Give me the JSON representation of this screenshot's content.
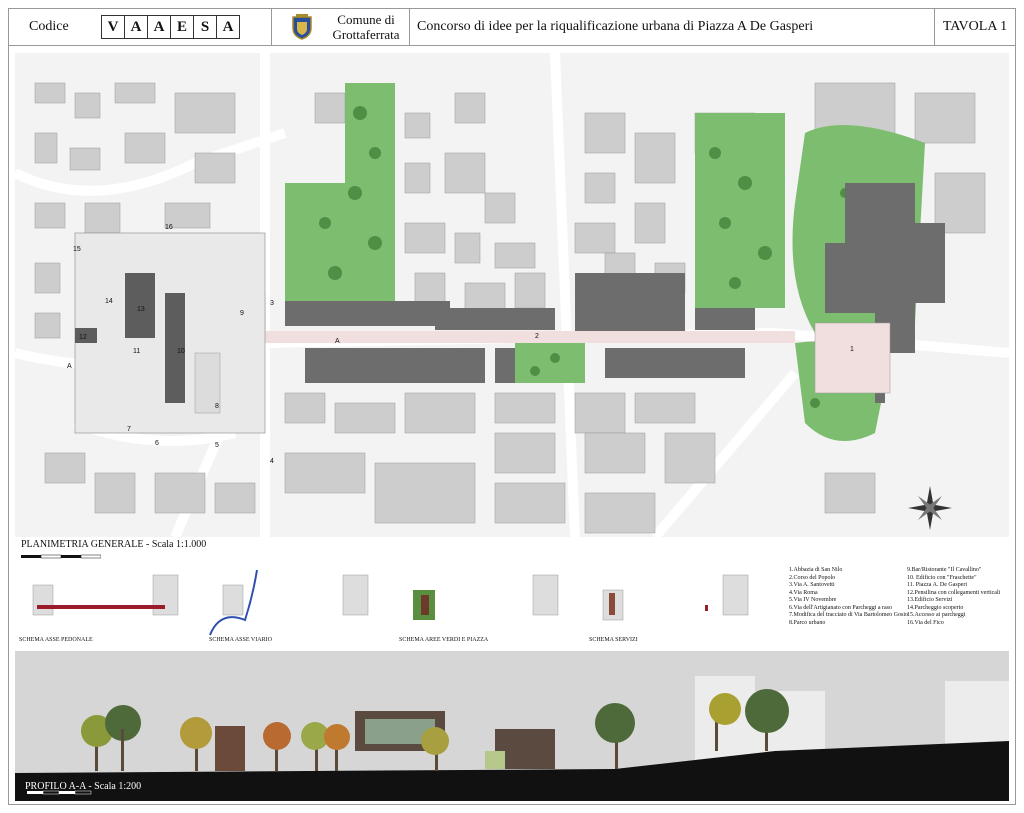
{
  "header": {
    "codice_label": "Codice",
    "code_letters": [
      "V",
      "A",
      "A",
      "E",
      "S",
      "A"
    ],
    "comune_line1": "Comune di",
    "comune_line2": "Grottaferrata",
    "concorso": "Concorso di idee per la riqualificazione urbana di Piazza A De Gasperi",
    "tavola": "TAVOLA 1"
  },
  "plan": {
    "title": "PLANIMETRIA  GENERALE  - Scala 1:1.000",
    "labels": [
      "1",
      "2",
      "3",
      "4",
      "5",
      "6",
      "7",
      "8",
      "9",
      "10",
      "11",
      "12",
      "13",
      "14",
      "15",
      "16",
      "A",
      "A"
    ],
    "colors": {
      "green": "#7cbd6f",
      "dark_building": "#6b6b6b",
      "light_building": "#c9c9c9",
      "road": "#eeeeee",
      "plaza": "#f1dede"
    }
  },
  "schemas": [
    {
      "label": "SCHEMA ASSE PEDONALE",
      "accent": "#9c1b2a"
    },
    {
      "label": "SCHEMA ASSE VIARIO",
      "accent": "#2f4fb0"
    },
    {
      "label": "SCHEMA AREE VERDI E PIAZZA",
      "accent": "#5a8f3f"
    },
    {
      "label": "SCHEMA SERVIZI",
      "accent": "#8a4a3a"
    }
  ],
  "legend_left": [
    "1.Abbazia di San Nilo",
    "2.Corso del Popolo",
    "3.Via A. Santovetti",
    "4.Via Roma",
    "5.Via IV Novembre",
    "6.Via dell'Artigianato con Parcheggi a raso",
    "7.Modifica del tracciato di Via Bartolomeo Gosio",
    "8.Parco urbano"
  ],
  "legend_right": [
    "9.Bar/Ristorante \"Il Cavallino\"",
    "10. Edificio con \"Fraschette\"",
    "11. Piazza A. De Gasperi",
    "12.Pensilina con collegamenti verticali",
    "13.Edificio Servizi",
    "14.Parcheggio scoperto",
    "15.Accesso ai parcheggi",
    "16.Via del Fico"
  ],
  "section": {
    "title": "PROFILO A-A - Scala 1:200"
  }
}
